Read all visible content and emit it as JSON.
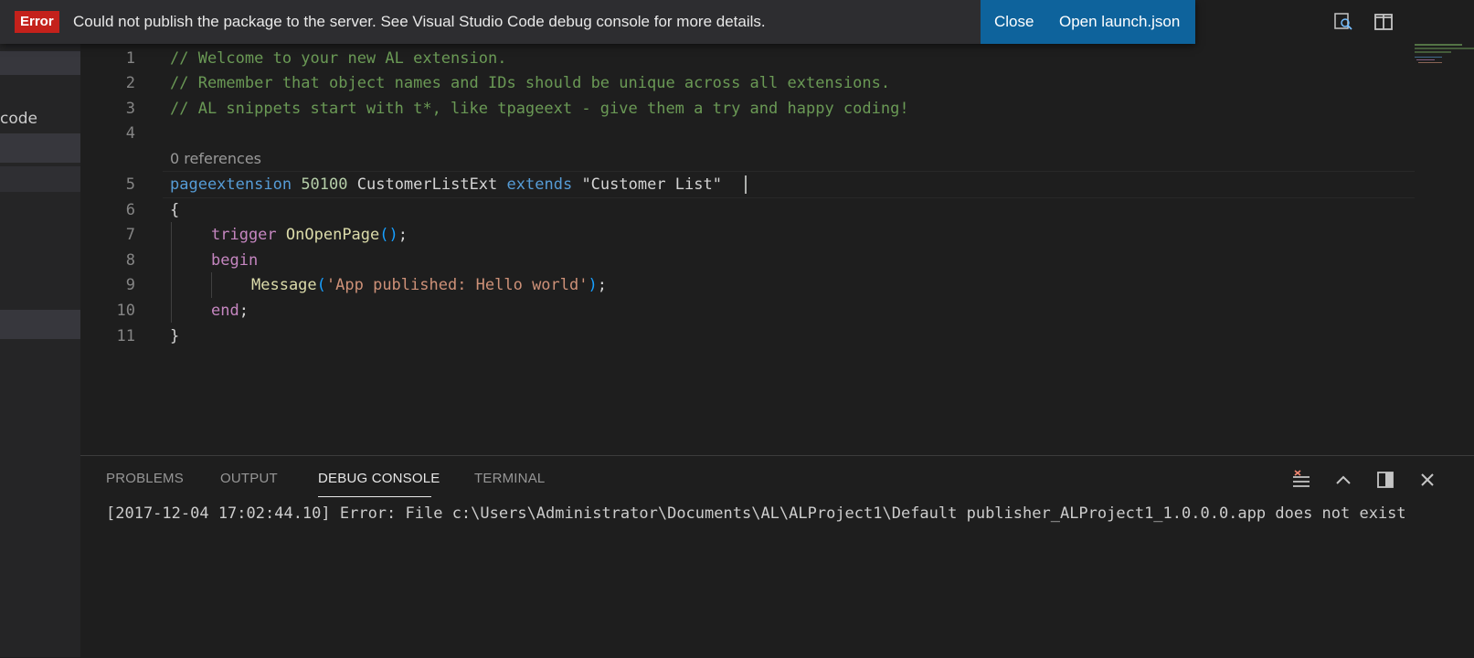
{
  "notification": {
    "severity": "Error",
    "message": "Could not publish the package to the server. See Visual Studio Code debug console for more details.",
    "close_label": "Close",
    "open_launch_label": "Open launch.json"
  },
  "sidebar": {
    "partial_text": "code"
  },
  "editor": {
    "codelens": "0 references",
    "line_numbers": [
      "1",
      "2",
      "3",
      "4",
      "5",
      "6",
      "7",
      "8",
      "9",
      "10",
      "11"
    ],
    "lines": {
      "l1": "// Welcome to your new AL extension.",
      "l2": "// Remember that object names and IDs should be unique across all extensions.",
      "l3": "// AL snippets start with t*, like tpageext - give them a try and happy coding!",
      "l5": {
        "kw1": "pageextension",
        "num": "50100",
        "name": "CustomerListExt",
        "kw2": "extends",
        "target": "\"Customer List\""
      },
      "l6": "{",
      "l7": {
        "kw": "trigger",
        "fn": "OnOpenPage",
        "parens": "()",
        "semi": ";"
      },
      "l8": "begin",
      "l9": {
        "fn": "Message",
        "open": "(",
        "str": "'App published: Hello world'",
        "close": ")",
        "semi": ";"
      },
      "l10": {
        "kw": "end",
        "semi": ";"
      },
      "l11": "}"
    }
  },
  "panel": {
    "tabs": [
      "PROBLEMS",
      "OUTPUT",
      "DEBUG CONSOLE",
      "TERMINAL"
    ],
    "active_tab": "DEBUG CONSOLE",
    "console_output": "[2017-12-04 17:02:44.10] Error: File c:\\Users\\Administrator\\Documents\\AL\\ALProject1\\Default publisher_ALProject1_1.0.0.0.app does not exist"
  },
  "colors": {
    "accent": "#0e639c",
    "error_badge": "#c4211b",
    "comment": "#6a9955",
    "keyword": "#569cd6",
    "control": "#c586c0",
    "function": "#dcdcaa",
    "string": "#ce9178",
    "number": "#b5cea8"
  },
  "icons": {
    "top_right": [
      "open-preview-icon",
      "split-editor-icon"
    ],
    "panel": [
      "clear-console-icon",
      "maximize-panel-icon",
      "toggle-panel-layout-icon",
      "close-panel-icon"
    ]
  }
}
